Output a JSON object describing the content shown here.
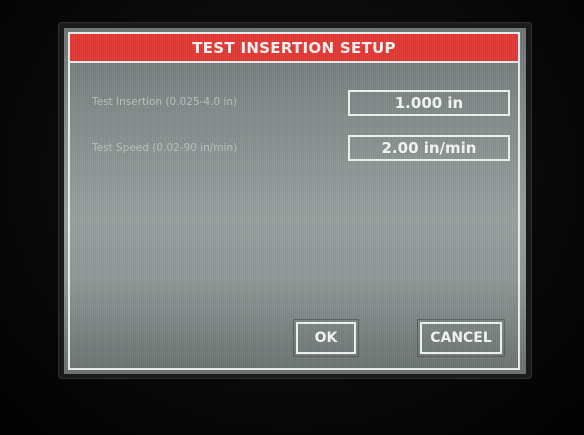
{
  "dialog": {
    "title": "TEST INSERTION SETUP"
  },
  "fields": [
    {
      "label": "Test Insertion (0.025-4.0 in)",
      "value": "1.000 in"
    },
    {
      "label": "Test Speed (0.02-90 in/min)",
      "value": "2.00 in/min"
    }
  ],
  "buttons": {
    "ok": "OK",
    "cancel": "CANCEL"
  },
  "colors": {
    "title_bar": "#e23a36",
    "screen_bg": "#8c9594",
    "border": "#e8eceb"
  }
}
